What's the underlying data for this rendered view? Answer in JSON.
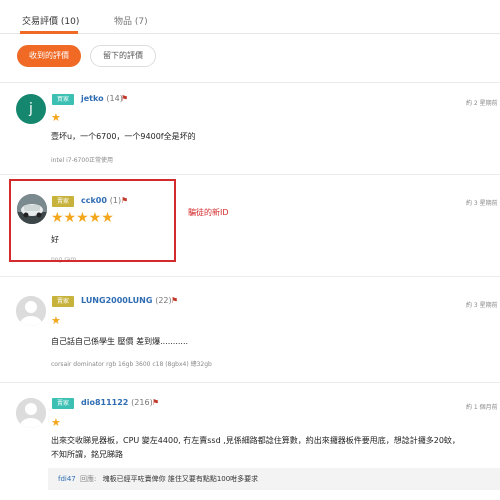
{
  "tabs": [
    {
      "label": "交易評價 (10)"
    },
    {
      "label": "物品 (7)"
    }
  ],
  "filters": {
    "received": "收到的評價",
    "left": "留下的評價"
  },
  "reviews": [
    {
      "badge": "買家",
      "badge_color": "#3cc0b4",
      "username": "jetko",
      "count": "(14)",
      "time": "約 2 星期前",
      "stars": "★",
      "text": "壹坏u，一个6700，一个9400f全是坏的",
      "product": "intel i7-6700正常使用",
      "avatar_letter": "j",
      "avatar_color": "#16876f"
    },
    {
      "badge": "賣家",
      "badge_color": "#c7b23c",
      "username": "cck00",
      "count": "(1)",
      "time": "約 3 星期前",
      "stars": "★★★★★",
      "text": "好",
      "product": "nog ram"
    },
    {
      "badge": "賣家",
      "badge_color": "#c7b23c",
      "username": "LUNG2000LUNG",
      "count": "(22)",
      "time": "約 3 星期前",
      "stars": "★",
      "text": "自己話自己係學生 壓價 差到爆...........",
      "product": "corsair dominator rgb 16gb 3600 c18 (8gbx4) 總32gb"
    },
    {
      "badge": "賣家",
      "badge_color": "#3cc0b4",
      "username": "dio811122",
      "count": "(216)",
      "time": "約 1 個月前",
      "stars": "★",
      "text_line1": "出來交收睇見器板，CPU 變左4400, 冇左賣ssd ,見係細路都諗住算數，約出來攞器板件要甩底，想諗計攞多20蚊，",
      "text_line2": "不知所謂，銘兄睇路",
      "reply_user": "fdi47",
      "reply_label": "回應:",
      "reply_text": "塊板已經平咗賣俾你 誰住又要有點點100咁多要求"
    }
  ],
  "annotation": "騙徒的新ID"
}
